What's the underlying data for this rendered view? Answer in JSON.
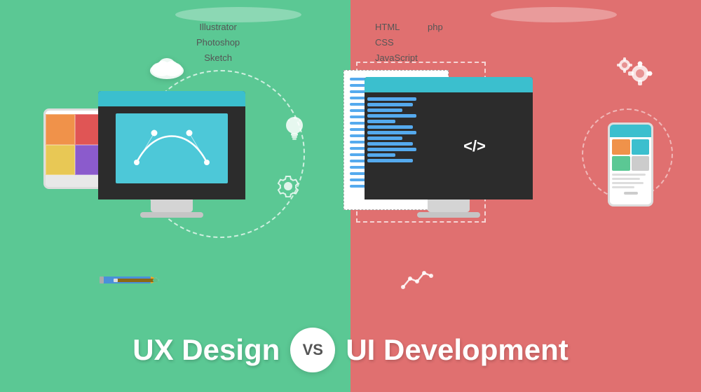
{
  "colors": {
    "bg_left": "#5bc894",
    "bg_right": "#e07070",
    "monitor_dark": "#2c2c2c",
    "monitor_bar": "#3bbfce",
    "white": "#ffffff"
  },
  "left_tools": {
    "label1": "Illustrator",
    "label2": "Photoshop",
    "label3": "Sketch"
  },
  "right_tools": {
    "col1": {
      "label1": "HTML",
      "label2": "CSS",
      "label3": "JavaScript"
    },
    "col2": {
      "label1": "php"
    }
  },
  "title": {
    "ux": "UX Design",
    "vs": "VS",
    "ui": "UI Development"
  },
  "code_tag": "</>",
  "vs_label": "VS"
}
